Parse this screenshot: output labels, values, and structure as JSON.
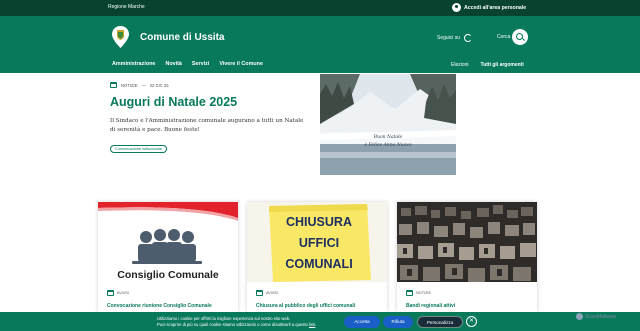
{
  "topbar": {
    "region": "Regione Marche",
    "login_label": "Accedi all'area personale"
  },
  "header": {
    "site_title": "Comune di Ussita",
    "follow_label": "Seguici su",
    "search_label": "Cerca",
    "nav": [
      "Amministrazione",
      "Novità",
      "Servizi",
      "Vivere il Comune"
    ],
    "nav_right": [
      "Elezioni",
      "Tutti gli argomenti"
    ]
  },
  "featured": {
    "category": "NOTIZIE",
    "date": "22 DIC 25",
    "title": "Auguri di Natale 2025",
    "text": "Il Sindaco e l'Amministrazione comunale augurano a tutti un Natale di serenità e pace. Buone feste!",
    "tag": "Comunicazione istituzionale",
    "image_caption_1": "Buon Natale",
    "image_caption_2": "e Felice Anno Nuovo"
  },
  "cards": [
    {
      "category": "AVVISI",
      "title": "Convocazione riunione Consiglio Comunale",
      "image_text": "Consiglio Comunale"
    },
    {
      "category": "AVVISI",
      "title": "Chiusura al pubblico degli uffici comunali",
      "image_text_1": "CHIUSURA",
      "image_text_2": "UFFICI",
      "image_text_3": "COMUNALI"
    },
    {
      "category": "NOTIZIE",
      "title": "Bandi regionali attivi"
    }
  ],
  "cookie": {
    "line1": "Utilizziamo i cookie per offrirti la migliore esperienza sul nostro sito web.",
    "line2": "Puoi scoprire di più su quali cookie stiamo utilizzando o come disattivarli a questo",
    "link": "link",
    "accept": "Accetta",
    "reject": "Rifiuta",
    "customize": "Personalizza",
    "close": "✕"
  },
  "watermark": "ScanMalware",
  "colors": {
    "primary": "#08795b",
    "dark": "#07432f",
    "button_blue": "#1a5fc7"
  }
}
